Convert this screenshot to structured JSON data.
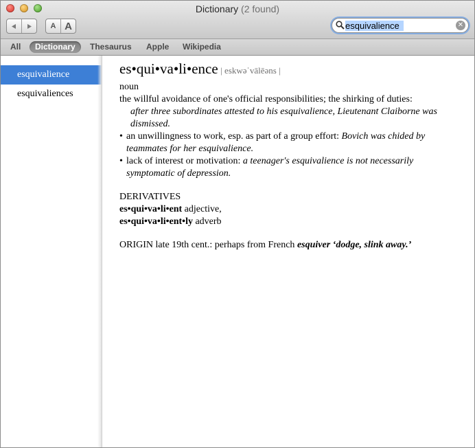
{
  "window": {
    "title": "Dictionary",
    "title_count": "(2 found)"
  },
  "toolbar": {
    "back_icon": "triangle-left",
    "forward_icon": "triangle-right",
    "font_smaller_label": "A",
    "font_larger_label": "A",
    "search_value": "esquivalience"
  },
  "scopes": [
    {
      "label": "All",
      "active": false
    },
    {
      "label": "Dictionary",
      "active": true
    },
    {
      "label": "Thesaurus",
      "active": false
    },
    {
      "label": "Apple",
      "active": false
    },
    {
      "label": "Wikipedia",
      "active": false
    }
  ],
  "sidebar": {
    "items": [
      {
        "label": "esquivalience",
        "selected": true
      },
      {
        "label": "esquivaliences",
        "selected": false
      }
    ]
  },
  "entry": {
    "headword": "es•qui•va•li•ence",
    "pronunciation": "| eskwəˈvālēəns |",
    "part_of_speech": "noun",
    "senses": [
      {
        "definition": "the willful avoidance of one's official responsibilities; the shirking of duties:",
        "example": "after three subordinates attested to his esquivalience, Lieutenant Claiborne was dismissed."
      },
      {
        "bullet": "•",
        "definition": "an unwillingness to work, esp. as part of a group effort:",
        "example": "Bovich was chided by teammates for her esquivalience."
      },
      {
        "bullet": "•",
        "definition": "lack of interest or motivation:",
        "example": "a teenager's esquivalience is not necessarily symptomatic of depression."
      }
    ],
    "derivatives": {
      "heading": "DERIVATIVES",
      "items": [
        {
          "form": "es•qui•va•li•ent",
          "pos": "adjective,"
        },
        {
          "form": "es•qui•va•li•ent•ly",
          "pos": "adverb"
        }
      ]
    },
    "origin": {
      "label": "ORIGIN",
      "text": "late 19th cent.: perhaps from French",
      "etymon": "esquiver ‘dodge, slink away.’"
    }
  },
  "colors": {
    "selection_blue": "#3d7fd6",
    "search_focus": "#87aee2"
  }
}
